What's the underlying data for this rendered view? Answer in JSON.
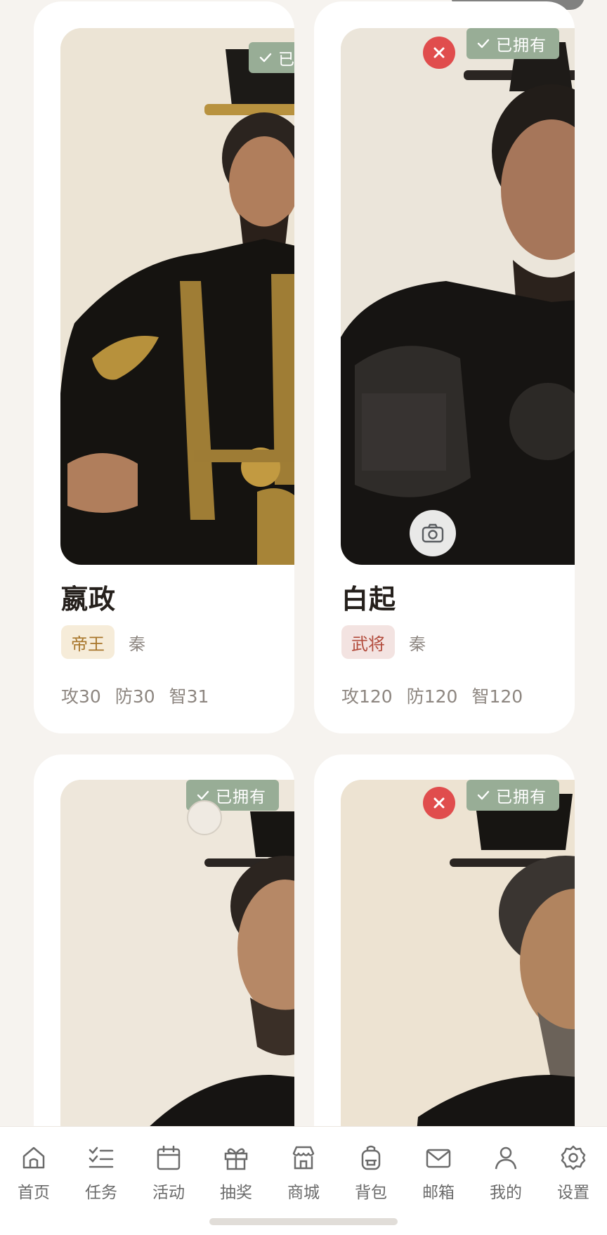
{
  "cards": [
    {
      "name": "嬴政",
      "owned_label": "已拥有",
      "role": "帝王",
      "faction": "秦",
      "stats": [
        "攻30",
        "防30",
        "智31"
      ]
    },
    {
      "name": "白起",
      "owned_label": "已拥有",
      "role": "武将",
      "faction": "秦",
      "stats": [
        "攻120",
        "防120",
        "智120"
      ]
    },
    {
      "owned_label": "已拥有"
    },
    {
      "owned_label": "已拥有"
    }
  ],
  "bottom_nav": {
    "items": [
      {
        "label": "首页",
        "icon": "home-icon"
      },
      {
        "label": "任务",
        "icon": "task-list-icon"
      },
      {
        "label": "活动",
        "icon": "calendar-icon"
      },
      {
        "label": "抽奖",
        "icon": "gift-icon"
      },
      {
        "label": "商城",
        "icon": "store-icon"
      },
      {
        "label": "背包",
        "icon": "backpack-icon"
      },
      {
        "label": "邮箱",
        "icon": "mail-icon"
      },
      {
        "label": "我的",
        "icon": "user-icon"
      },
      {
        "label": "设置",
        "icon": "gear-icon"
      }
    ]
  },
  "colors": {
    "background": "#f6f3ef",
    "owned_badge": "#98ad96",
    "remove_button": "#e04d4d",
    "emperor_tag_text": "#a8762b",
    "general_tag_text": "#b24b3c"
  }
}
